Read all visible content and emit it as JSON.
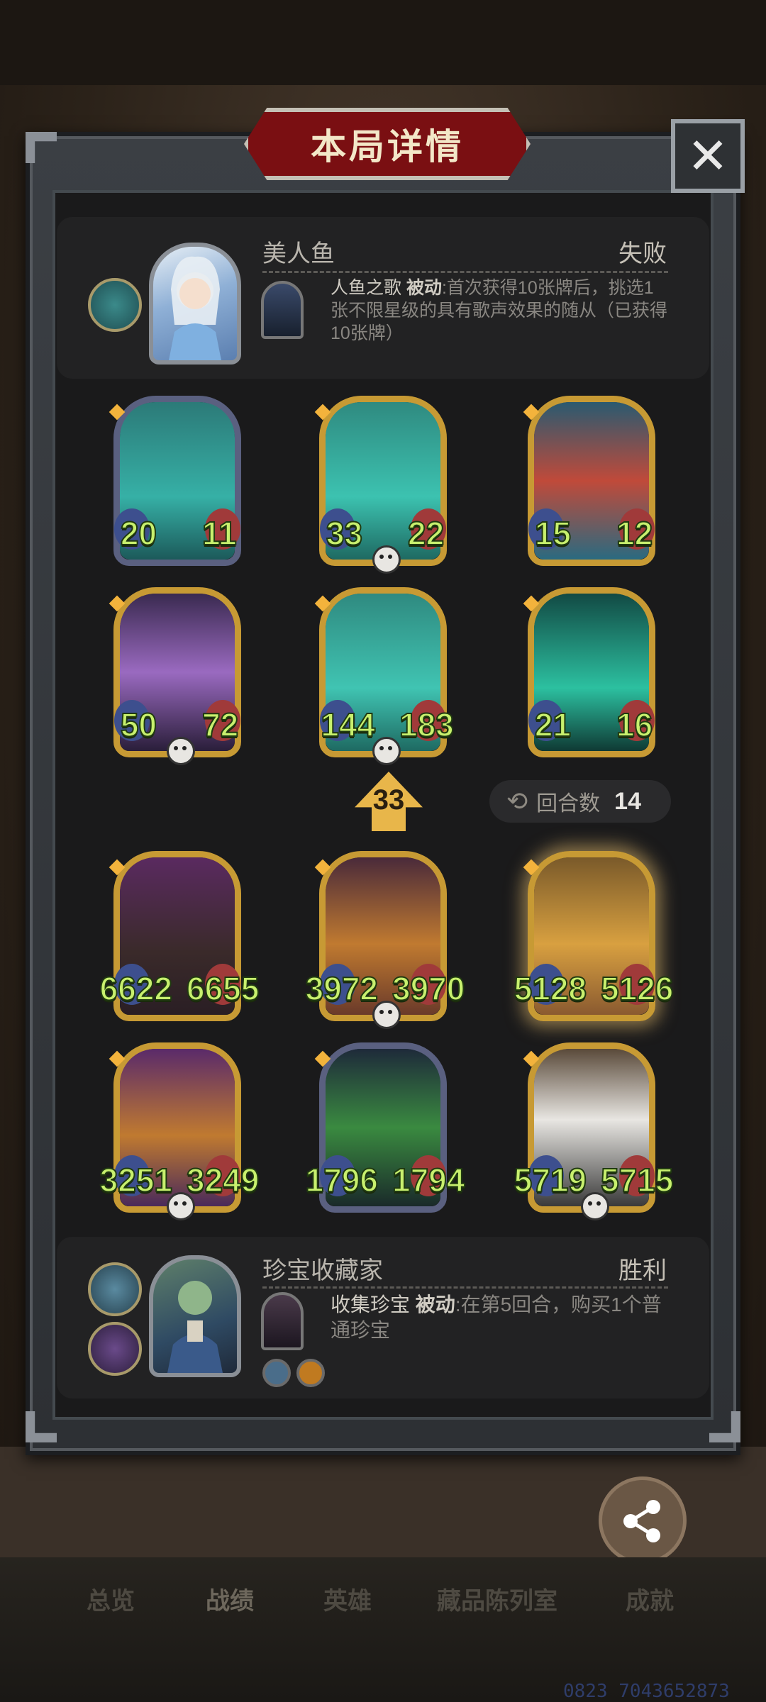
{
  "title": "本局详情",
  "close_icon": "close-icon",
  "opponent": {
    "name": "美人鱼",
    "result": "失败",
    "skill_name": "人鱼之歌",
    "skill_type": "被动",
    "skill_desc": ":首次获得10张牌后，挑选1张不限星级的具有歌声效果的随从（已获得10张牌）",
    "colors": {
      "result": "#c5c0b6"
    }
  },
  "opponent_board": [
    {
      "attack": "20",
      "health": "11",
      "art": "mermaid-singer",
      "skull": false,
      "frame": "silver"
    },
    {
      "attack": "33",
      "health": "22",
      "art": "mermaid-artist",
      "skull": true,
      "frame": "gold"
    },
    {
      "attack": "15",
      "health": "12",
      "art": "red-hair-mermaid",
      "skull": false,
      "frame": "gold"
    },
    {
      "attack": "50",
      "health": "72",
      "art": "purple-hair-singer",
      "skull": true,
      "frame": "gold"
    },
    {
      "attack": "144",
      "health": "183",
      "art": "mermaid-singer-gold",
      "skull": true,
      "frame": "gold"
    },
    {
      "attack": "21",
      "health": "16",
      "art": "sea-king-statue",
      "skull": false,
      "frame": "gold"
    }
  ],
  "level_badge": "33",
  "round_info": {
    "label": "回合数",
    "value": "14"
  },
  "player_board": [
    {
      "attack": "6622",
      "health": "6655",
      "art": "wild-boar",
      "skull": false,
      "frame": "gold"
    },
    {
      "attack": "3972",
      "health": "3970",
      "art": "raccoon",
      "skull": true,
      "frame": "gold"
    },
    {
      "attack": "5128",
      "health": "5126",
      "art": "raccoon-golden",
      "skull": false,
      "frame": "gold"
    },
    {
      "attack": "3251",
      "health": "3249",
      "art": "raccoon-purple",
      "skull": true,
      "frame": "gold"
    },
    {
      "attack": "1796",
      "health": "1794",
      "art": "green-flame-sword",
      "skull": false,
      "frame": "silver"
    },
    {
      "attack": "5719",
      "health": "5715",
      "art": "cow-monster",
      "skull": true,
      "frame": "gold"
    }
  ],
  "player": {
    "name": "珍宝收藏家",
    "result": "胜利",
    "skill_name": "收集珍宝",
    "skill_type": "被动",
    "skill_desc": ":在第5回合，购买1个普通珍宝"
  },
  "share": {
    "label": "分享",
    "icon": "share-icon"
  },
  "tabs": [
    "总览",
    "战绩",
    "英雄",
    "藏品陈列室",
    "成就"
  ],
  "footer_id": "0823 7043652873"
}
